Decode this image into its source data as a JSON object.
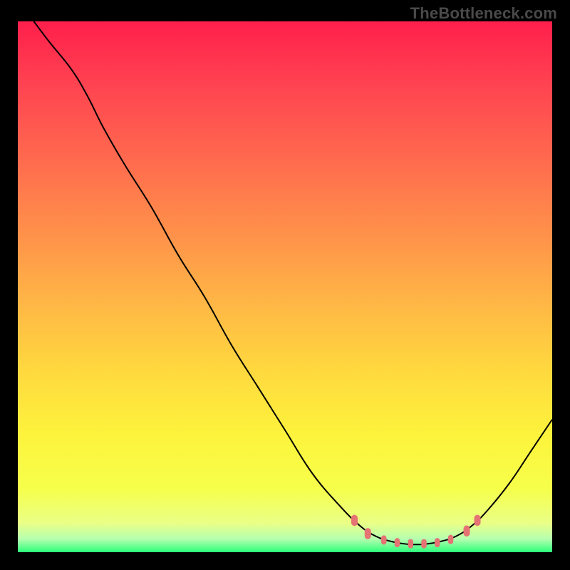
{
  "watermark": "TheBottleneck.com",
  "chart_data": {
    "type": "line",
    "title": "",
    "xlabel": "",
    "ylabel": "",
    "xlim": [
      0,
      100
    ],
    "ylim": [
      0,
      100
    ],
    "grid": false,
    "series": [
      {
        "name": "curve",
        "points": [
          {
            "x": 3,
            "y": 100
          },
          {
            "x": 6,
            "y": 96
          },
          {
            "x": 10,
            "y": 91
          },
          {
            "x": 13,
            "y": 86
          },
          {
            "x": 16,
            "y": 80
          },
          {
            "x": 20,
            "y": 73
          },
          {
            "x": 25,
            "y": 65
          },
          {
            "x": 30,
            "y": 56
          },
          {
            "x": 35,
            "y": 48
          },
          {
            "x": 40,
            "y": 39
          },
          {
            "x": 45,
            "y": 31
          },
          {
            "x": 50,
            "y": 23
          },
          {
            "x": 55,
            "y": 15
          },
          {
            "x": 60,
            "y": 9
          },
          {
            "x": 64,
            "y": 5
          },
          {
            "x": 67,
            "y": 3
          },
          {
            "x": 70,
            "y": 2
          },
          {
            "x": 73,
            "y": 1.5
          },
          {
            "x": 76,
            "y": 1.5
          },
          {
            "x": 79,
            "y": 2
          },
          {
            "x": 82,
            "y": 3
          },
          {
            "x": 85,
            "y": 5
          },
          {
            "x": 88,
            "y": 8
          },
          {
            "x": 92,
            "y": 13
          },
          {
            "x": 96,
            "y": 19
          },
          {
            "x": 100,
            "y": 25
          }
        ]
      }
    ],
    "markers": {
      "name": "highlight-dots",
      "color": "#e57373",
      "points": [
        {
          "x": 63.0,
          "y": 6.0,
          "r": 6
        },
        {
          "x": 65.5,
          "y": 3.5,
          "r": 6
        },
        {
          "x": 68.5,
          "y": 2.3,
          "r": 5
        },
        {
          "x": 71.0,
          "y": 1.8,
          "r": 5
        },
        {
          "x": 73.5,
          "y": 1.6,
          "r": 5
        },
        {
          "x": 76.0,
          "y": 1.6,
          "r": 5
        },
        {
          "x": 78.5,
          "y": 1.8,
          "r": 5
        },
        {
          "x": 81.0,
          "y": 2.4,
          "r": 5
        },
        {
          "x": 84.0,
          "y": 4.0,
          "r": 6
        },
        {
          "x": 86.0,
          "y": 6.0,
          "r": 6
        }
      ]
    },
    "gradient_stops": [
      {
        "offset": 0.0,
        "color": "#ff1f4b"
      },
      {
        "offset": 0.12,
        "color": "#ff4351"
      },
      {
        "offset": 0.26,
        "color": "#ff6a4e"
      },
      {
        "offset": 0.4,
        "color": "#ff914a"
      },
      {
        "offset": 0.54,
        "color": "#ffb945"
      },
      {
        "offset": 0.66,
        "color": "#ffd93e"
      },
      {
        "offset": 0.78,
        "color": "#fdf33c"
      },
      {
        "offset": 0.88,
        "color": "#f6ff4a"
      },
      {
        "offset": 0.945,
        "color": "#eaff86"
      },
      {
        "offset": 0.975,
        "color": "#b6ffb0"
      },
      {
        "offset": 1.0,
        "color": "#2bff7a"
      }
    ]
  }
}
